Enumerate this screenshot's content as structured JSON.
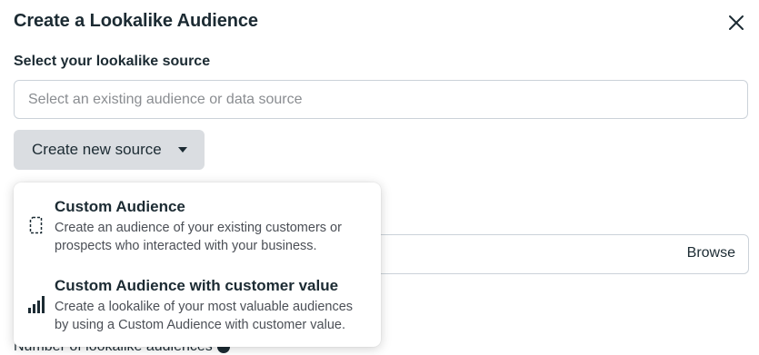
{
  "dialog": {
    "title": "Create a Lookalike Audience",
    "close_icon": "close-icon"
  },
  "source": {
    "label": "Select your lookalike source",
    "placeholder": "Select an existing audience or data source",
    "value": ""
  },
  "create_source": {
    "label": "Create new source",
    "icon": "caret-down-icon"
  },
  "menu": {
    "items": [
      {
        "title": "Custom Audience",
        "description": "Create an audience of your existing customers or prospects who interacted with your business.",
        "icon": "document-icon"
      },
      {
        "title": "Custom Audience with customer value",
        "description": "Create a lookalike of your most valuable audiences by using a Custom Audience with customer value.",
        "icon": "bar-chart-icon"
      }
    ]
  },
  "location": {
    "browse_label": "Browse"
  },
  "number_of_audiences": {
    "label": "Number of lookalike audiences"
  }
}
